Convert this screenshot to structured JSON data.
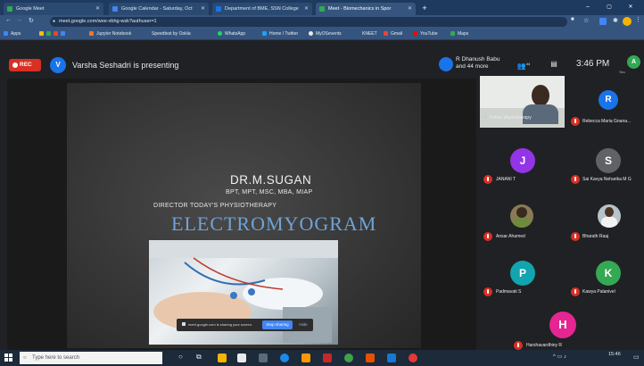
{
  "browser": {
    "tabs": [
      {
        "title": "Google Meet",
        "color": "#34a853"
      },
      {
        "title": "Google Calendar - Saturday, Oct",
        "color": "#4285f4"
      },
      {
        "title": "Department of BME, SSN College",
        "color": "#1a73e8"
      },
      {
        "title": "Meet - Biomechanics in Spor",
        "color": "#34a853"
      }
    ],
    "url": "meet.google.com/wee-vbhg-wsk?authuser=1",
    "bookmarks": [
      "Apps",
      "Jupyter Notebook",
      "Speedtest by Ookla",
      "WhatsApp",
      "Home / Twitter",
      "MyOSevents",
      "KNEET",
      "Gmail",
      "YouTube",
      "Maps"
    ]
  },
  "meet": {
    "rec_label": "REC",
    "presenter_initial": "V",
    "presenting_text": "Varsha Seshadri is presenting",
    "people_line1": "R Dhanush Babu",
    "people_line2": "and 44 more",
    "people_count": "44",
    "time": "3:46 PM",
    "me_initial": "A",
    "me_label": "You"
  },
  "slide": {
    "name": "DR.M.SUGAN",
    "qualifications": "BPT, MPT, MSC, MBA, MIAP",
    "role": "DIRECTOR TODAY'S PHYSIOTHERAPY",
    "title": "ELECTROMYOGRAM",
    "share_notice": "meet.google.com is sharing your screen.",
    "stop_label": "Stop sharing",
    "hide_label": "Hide"
  },
  "participants": [
    {
      "name": "Vishnu physiotherapy",
      "type": "video",
      "muted": false
    },
    {
      "name": "Rebecca Maria Gnana...",
      "initial": "R",
      "color": "#1a73e8",
      "muted": true
    },
    {
      "name": "JANANI T",
      "initial": "J",
      "color": "#9334e6",
      "muted": true
    },
    {
      "name": "Sai Kavya Neharika M G",
      "initial": "S",
      "color": "#5f6368",
      "muted": true
    },
    {
      "name": "Ansar Ahamed",
      "type": "photo",
      "muted": true
    },
    {
      "name": "Bharath Raaj",
      "type": "photo",
      "muted": true
    },
    {
      "name": "Padmavati S",
      "initial": "P",
      "color": "#12a4af",
      "muted": true
    },
    {
      "name": "Kawya Palanivel",
      "initial": "K",
      "color": "#34a853",
      "muted": true
    },
    {
      "name": "Harshavardhiny R",
      "initial": "H",
      "color": "#e52592",
      "muted": true
    }
  ],
  "taskbar": {
    "search_placeholder": "Type here to search",
    "time": "15:46"
  }
}
